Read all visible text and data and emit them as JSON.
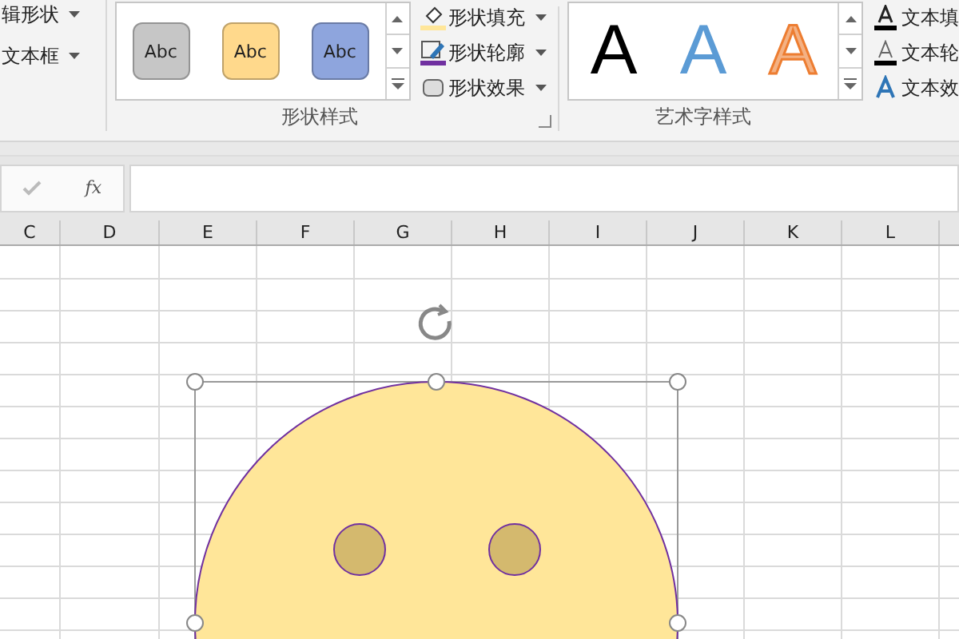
{
  "ribbon": {
    "insert_group": {
      "commands": [
        {
          "label": "辑形状",
          "dropdown": true
        },
        {
          "label": "文本框",
          "dropdown": true
        }
      ]
    },
    "shape_styles": {
      "label": "形状样式",
      "gallery": [
        {
          "label": "Abc",
          "color": "#c6c6c6"
        },
        {
          "label": "Abc",
          "color": "#ffd98c"
        },
        {
          "label": "Abc",
          "color": "#8ea5dd"
        }
      ],
      "commands": [
        {
          "label": "形状填充",
          "kind": "fill"
        },
        {
          "label": "形状轮廓",
          "kind": "outline"
        },
        {
          "label": "形状效果",
          "kind": "effect"
        }
      ]
    },
    "wordart_styles": {
      "label": "艺术字样式",
      "gallery": [
        {
          "label": "A",
          "color": "#000000"
        },
        {
          "label": "A",
          "color": "#5b9bd5"
        },
        {
          "label": "A",
          "color": "#f4b183"
        }
      ],
      "commands": [
        {
          "label": "文本填",
          "kind": "fill"
        },
        {
          "label": "文本轮",
          "kind": "outline"
        },
        {
          "label": "文本效",
          "kind": "effect"
        }
      ]
    }
  },
  "formula_bar": {
    "function_label": "fx"
  },
  "columns": [
    "C",
    "D",
    "E",
    "F",
    "G",
    "H",
    "I",
    "J",
    "K",
    "L"
  ]
}
